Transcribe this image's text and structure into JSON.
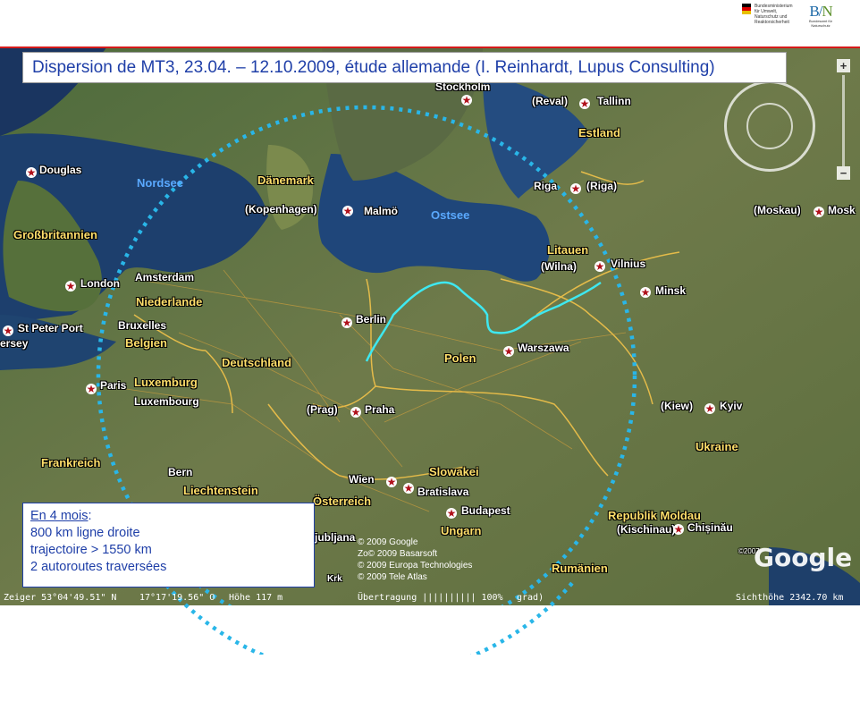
{
  "header": {
    "logo_bmu_text": "Bundesministerium für Umwelt, Naturschutz und Reaktorsicherheit",
    "logo_bfn_mark_b": "B",
    "logo_bfn_mark_n": "N",
    "logo_bfn_text": "Bundesamt für Naturschutz"
  },
  "title": "Dispersion de  MT3, 23.04. – 12.10.2009, étude allemande (I. Reinhardt, Lupus Consulting)",
  "info_box": {
    "heading": "En 4 mois",
    "heading_suffix": ":",
    "lines": [
      "800 km ligne droite",
      "trajectoire  > 1550 km",
      "2 autoroutes traversées"
    ]
  },
  "map": {
    "seas": [
      "Nordsee",
      "Ostsee"
    ],
    "countries": [
      "Dänemark",
      "Großbritannien",
      "Niederlande",
      "Belgien",
      "Deutschland",
      "Luxemburg",
      "Frankreich",
      "Liechtenstein",
      "Österreich",
      "Slowakei",
      "Ungarn",
      "Polen",
      "Estland",
      "Litauen",
      "Ukraine",
      "Republik Moldau",
      "Rumänien"
    ],
    "cities": [
      "Stockholm",
      "(Reval)",
      "Tallinn",
      "Douglas",
      "(Riga)",
      "Riga",
      "(Kopenhagen)",
      "Malmö",
      "(Moskau)",
      "Mosk",
      "(Wilna)",
      "Vilnius",
      "London",
      "Amsterdam",
      "Minsk",
      "Berlin",
      "St Peter Port",
      "ersey",
      "Bruxelles",
      "Warszawa",
      "Paris",
      "Luxembourg",
      "(Prag)",
      "Praha",
      "(Kiew)",
      "Kyiv",
      "Bern",
      "Wien",
      "Bratislava",
      "Budapest",
      "(Kischinau)",
      "Chișinău",
      "jubljana",
      "Krk"
    ],
    "track_color": "#3ee8f0",
    "circle_color": "#29b6e8"
  },
  "copyright": "© 2009 Google\nZo© 2009 Basarsoft\n© 2009 Europa Technologies\n© 2009 Tele Atlas",
  "google_logo": "Google",
  "copyright_small": "©2007",
  "status_bar": {
    "pointer": "Zeiger  53°04'49.51\" N",
    "lon": "17°17'19.56\" O",
    "height": "Höhe  117 m",
    "stream": "Übertragung |||||||||| 100%",
    "grad": "grad)",
    "eye_alt": "Sichthöhe  2342.70 km"
  },
  "nav": {
    "zoom_in": "+",
    "zoom_out": "−"
  }
}
